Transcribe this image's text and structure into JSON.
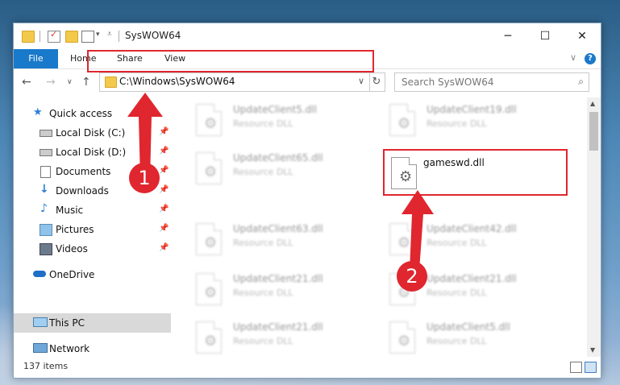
{
  "window": {
    "title": "SysWOW64"
  },
  "ribbon": {
    "tabs": [
      "File",
      "Home",
      "Share",
      "View"
    ],
    "help": "?"
  },
  "nav": {
    "address": "C:\\Windows\\SysWOW64",
    "search_placeholder": "Search SysWOW64"
  },
  "sidebar": {
    "items": [
      {
        "label": "Quick access",
        "icon": "star-icon",
        "pinned": false
      },
      {
        "label": "Local Disk (C:)",
        "icon": "drive-icon",
        "pinned": true
      },
      {
        "label": "Local Disk (D:)",
        "icon": "drive-icon",
        "pinned": true
      },
      {
        "label": "Documents",
        "icon": "document-icon",
        "pinned": true
      },
      {
        "label": "Downloads",
        "icon": "download-icon",
        "pinned": true
      },
      {
        "label": "Music",
        "icon": "music-icon",
        "pinned": true
      },
      {
        "label": "Pictures",
        "icon": "pictures-icon",
        "pinned": true
      },
      {
        "label": "Videos",
        "icon": "videos-icon",
        "pinned": true
      },
      {
        "label": "OneDrive",
        "icon": "cloud-icon",
        "pinned": false
      },
      {
        "label": "This PC",
        "icon": "computer-icon",
        "pinned": false,
        "selected": true
      },
      {
        "label": "Network",
        "icon": "network-icon",
        "pinned": false
      }
    ]
  },
  "files": [
    {
      "name": "UpdateClient5.dll",
      "type": "Resource DLL"
    },
    {
      "name": "UpdateClient19.dll",
      "type": "Resource DLL"
    },
    {
      "name": "UpdateClient65.dll",
      "type": "Resource DLL"
    },
    {
      "name": "gameswd.dll",
      "type": "",
      "highlighted": true
    },
    {
      "name": "UpdateClient63.dll",
      "type": "Resource DLL"
    },
    {
      "name": "UpdateClient42.dll",
      "type": "Resource DLL"
    },
    {
      "name": "UpdateClient21.dll",
      "type": "Resource DLL"
    },
    {
      "name": "UpdateClient21.dll",
      "type": "Resource DLL"
    },
    {
      "name": "UpdateClient21.dll",
      "type": "Resource DLL"
    },
    {
      "name": "UpdateClient5.dll",
      "type": "Resource DLL"
    }
  ],
  "status": {
    "item_count": "137 items"
  },
  "annotations": {
    "step1": "1",
    "step2": "2",
    "color": "#e0262e"
  }
}
